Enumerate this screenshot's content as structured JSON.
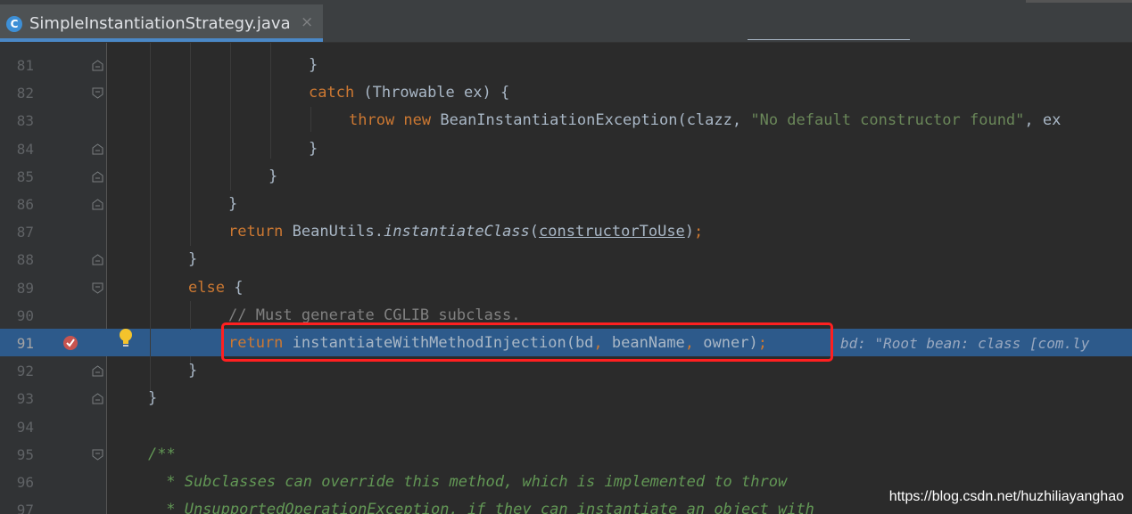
{
  "tab": {
    "badge": "C",
    "title": "SimpleInstantiationStrategy.java",
    "close": "×"
  },
  "lines": [
    {
      "n": "81",
      "html": "<span>}</span>"
    },
    {
      "n": "82",
      "html": "<span class=\"kw\">catch</span> (Throwable ex) {"
    },
    {
      "n": "83",
      "html": "<span class=\"kw\">throw new</span> BeanInstantiationException(clazz, <span class=\"str\">\"No default constructor found\"</span>, ex"
    },
    {
      "n": "84",
      "html": "}"
    },
    {
      "n": "85",
      "html": "}"
    },
    {
      "n": "86",
      "html": "}"
    },
    {
      "n": "87",
      "html": "<span class=\"kw\">return</span> BeanUtils.<span class=\"it\">instantiateClass</span>(<span class=\"ul\">constructorToUse</span>)<span class=\"kw\">;</span>"
    },
    {
      "n": "88",
      "html": "}"
    },
    {
      "n": "89",
      "html": "<span class=\"kw\">else</span> {"
    },
    {
      "n": "90",
      "html": "<span class=\"cm\">// Must generate CGLIB subclass.</span>"
    },
    {
      "n": "91",
      "html": "<span class=\"kw\">return</span> instantiateWithMethodInjection(bd<span class=\"kw\">,</span> beanName<span class=\"kw\">,</span> owner)<span class=\"kw\">;</span>"
    },
    {
      "n": "92",
      "html": "}"
    },
    {
      "n": "93",
      "html": "}"
    },
    {
      "n": "94",
      "html": ""
    },
    {
      "n": "95",
      "html": "<span class=\"doc\">/**</span>"
    },
    {
      "n": "96",
      "html": "<span class=\"doc\"> * Subclasses can override this method, which is implemented to throw</span>"
    },
    {
      "n": "97",
      "html": "<span class=\"doc\"> * UnsupportedOperationException, if they can instantiate an object with</span>"
    }
  ],
  "inlay_hint": "bd: \"Root bean: class [com.ly",
  "watermark": "https://blog.csdn.net/huzhiliayanghao",
  "colors": {
    "keyword": "#cc7832",
    "string": "#6a8759",
    "comment": "#808080",
    "javadoc": "#629755",
    "highlight": "#2d5a8b",
    "annotation_box": "#ff2020"
  }
}
